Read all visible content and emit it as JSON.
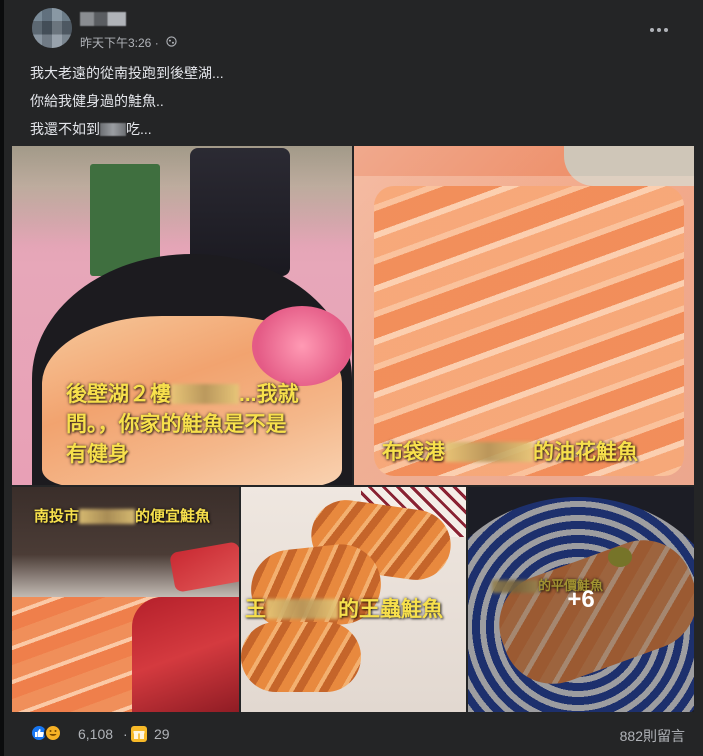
{
  "post": {
    "timestamp": "昨天下午3:26 ·",
    "lines": [
      "我大老遠的從南投跑到後壁湖...",
      "你給我健身過的鮭魚..",
      "我還不如到",
      "吃..."
    ]
  },
  "photos": [
    {
      "caption_a": "後壁湖２樓",
      "caption_b": "...我就",
      "caption_c": "問。，你家的鮭魚是不是",
      "caption_d": "有健身"
    },
    {
      "caption_a": "布袋港",
      "caption_b": "的油花鮭魚"
    },
    {
      "caption_a": "南投市",
      "caption_b": "的便宜鮭魚"
    },
    {
      "caption_a": "王",
      "caption_b": "的王蟲鮭魚"
    },
    {
      "caption_a": "的平價鮭魚",
      "more_label": "+6"
    }
  ],
  "footer": {
    "reaction_count": "6,108",
    "dot": "·",
    "gift_count": "29",
    "comment_count": "882則留言"
  },
  "colors": {
    "background": "#242526",
    "caption": "#f7e04c",
    "like": "#1877f2"
  },
  "icons": [
    "avatar",
    "globe-icon",
    "more-options-icon",
    "like-reaction-icon",
    "haha-reaction-icon",
    "gift-icon"
  ]
}
